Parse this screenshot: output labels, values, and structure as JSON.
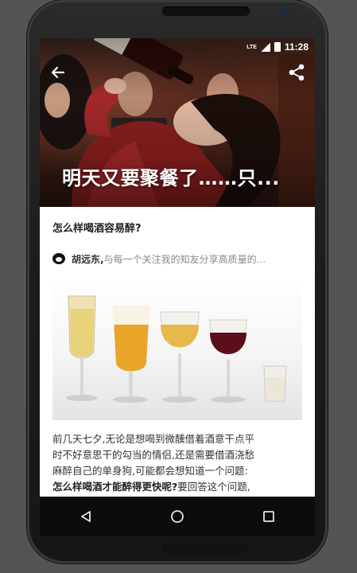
{
  "status_bar": {
    "time": "11:28",
    "network_badge": "LTE",
    "icons": [
      "signal-icon",
      "battery-icon"
    ]
  },
  "toolbar": {
    "back_icon": "arrow-left-icon",
    "share_icon": "share-icon"
  },
  "hero": {
    "title": "明天又要聚餐了……只..."
  },
  "question": {
    "title": "怎么样喝酒容易醉?"
  },
  "author": {
    "name": "胡远东,",
    "bio": "与每一个关注我的知友分享高质量的..."
  },
  "article": {
    "line1": "前几天七夕,无论是想喝到微醺借着酒意干点平",
    "line2": "时不好意思干的勾当的情侣,还是需要借酒浇愁",
    "line3": "麻醉自己的单身狗,可能都会想知道一个问题:",
    "line4_bold": "怎么样喝酒才能醉得更快呢?",
    "line4_rest": "要回答这个问题,"
  },
  "nav": {
    "back": "back-triangle-icon",
    "home": "home-circle-icon",
    "recents": "recents-square-icon"
  }
}
